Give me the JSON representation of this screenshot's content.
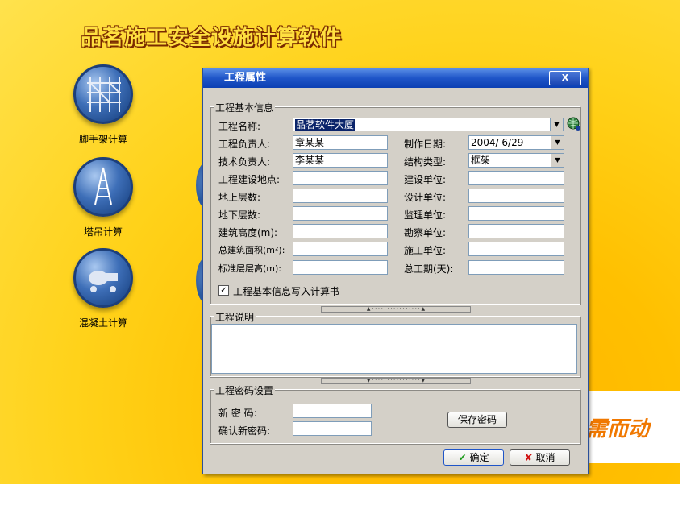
{
  "app": {
    "title": "品茗施工安全设施计算软件",
    "slogan": "需而动",
    "sidebar": [
      {
        "label": "脚手架计算",
        "icon": "scaffold-icon"
      },
      {
        "label": "塔吊计算",
        "icon": "tower-crane-icon"
      },
      {
        "label": "混凝土计算",
        "icon": "concrete-icon"
      }
    ]
  },
  "dialog": {
    "title": "工程属性",
    "close_label": "X",
    "basic": {
      "legend": "工程基本信息",
      "name_label": "工程名称:",
      "name_value": "品茗软件大厦",
      "left_fields": [
        {
          "label": "工程负责人:",
          "value": "章某某"
        },
        {
          "label": "技术负责人:",
          "value": "李某某"
        },
        {
          "label": "工程建设地点:",
          "value": ""
        },
        {
          "label": "地上层数:",
          "value": ""
        },
        {
          "label": "地下层数:",
          "value": ""
        },
        {
          "label": "建筑高度(m):",
          "value": ""
        },
        {
          "label": "总建筑面积(m²):",
          "value": ""
        },
        {
          "label": "标准层层高(m):",
          "value": ""
        }
      ],
      "right_fields": [
        {
          "label": "制作日期:",
          "value": "2004/ 6/29"
        },
        {
          "label": "结构类型:",
          "value": "框架"
        },
        {
          "label": "建设单位:",
          "value": ""
        },
        {
          "label": "设计单位:",
          "value": ""
        },
        {
          "label": "监理单位:",
          "value": ""
        },
        {
          "label": "勘察单位:",
          "value": ""
        },
        {
          "label": "施工单位:",
          "value": ""
        },
        {
          "label": "总工期(天):",
          "value": ""
        }
      ],
      "checkbox_label": "工程基本信息写入计算书",
      "checkbox_checked": "✓"
    },
    "description": {
      "legend": "工程说明",
      "value": ""
    },
    "password": {
      "legend": "工程密码设置",
      "new_label": "新  密  码:",
      "confirm_label": "确认新密码:",
      "save_button": "保存密码"
    },
    "ok_button": "确定",
    "cancel_button": "取消"
  }
}
